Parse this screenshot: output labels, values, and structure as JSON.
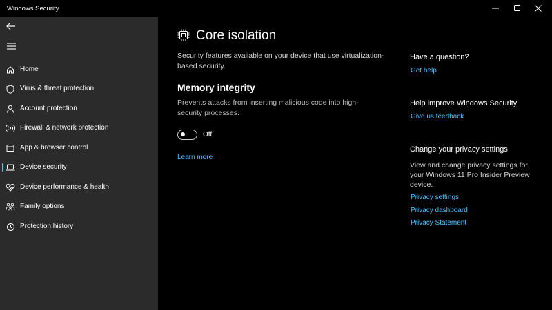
{
  "window": {
    "title": "Windows Security"
  },
  "sidebar": {
    "items": [
      {
        "label": "Home",
        "icon": "home-icon"
      },
      {
        "label": "Virus & threat protection",
        "icon": "shield-icon"
      },
      {
        "label": "Account protection",
        "icon": "person-icon"
      },
      {
        "label": "Firewall & network protection",
        "icon": "wifi-antenna-icon"
      },
      {
        "label": "App & browser control",
        "icon": "app-window-icon"
      },
      {
        "label": "Device security",
        "icon": "laptop-icon",
        "active": true
      },
      {
        "label": "Device performance & health",
        "icon": "heart-pulse-icon"
      },
      {
        "label": "Family options",
        "icon": "family-icon"
      },
      {
        "label": "Protection history",
        "icon": "history-icon"
      }
    ]
  },
  "main": {
    "title": "Core isolation",
    "description": "Security features available on your device that use virtualization-based security.",
    "memory_integrity": {
      "title": "Memory integrity",
      "description": "Prevents attacks from inserting malicious code into high-security processes.",
      "toggle_state": "Off",
      "learn_more": "Learn more"
    }
  },
  "right": {
    "question": {
      "heading": "Have a question?",
      "link": "Get help"
    },
    "improve": {
      "heading": "Help improve Windows Security",
      "link": "Give us feedback"
    },
    "privacy": {
      "heading": "Change your privacy settings",
      "text": "View and change privacy settings for your Windows 11 Pro Insider Preview device.",
      "links": [
        "Privacy settings",
        "Privacy dashboard",
        "Privacy Statement"
      ]
    }
  },
  "colors": {
    "accent": "#4cc2ff",
    "sidebar_bg": "#2b2b2b",
    "main_bg": "#000000"
  }
}
